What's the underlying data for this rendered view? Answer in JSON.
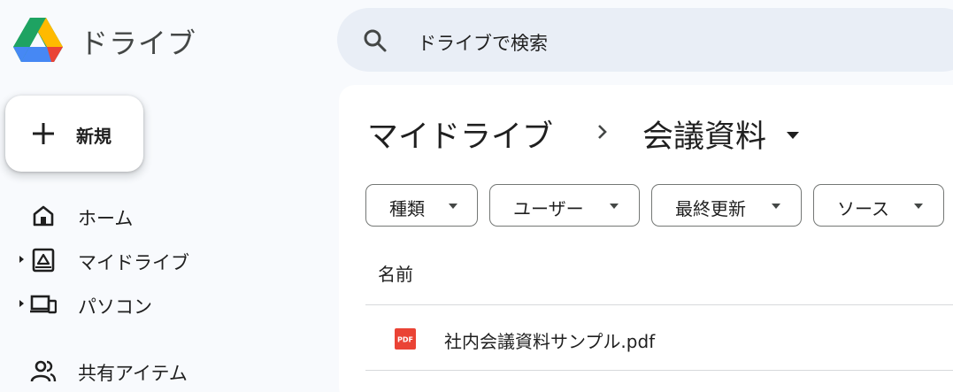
{
  "app": {
    "title": "ドライブ"
  },
  "search": {
    "placeholder": "ドライブで検索"
  },
  "sidebar": {
    "new_label": "新規",
    "items": [
      {
        "label": "ホーム",
        "icon": "home-icon"
      },
      {
        "label": "マイドライブ",
        "icon": "my-drive-icon"
      },
      {
        "label": "パソコン",
        "icon": "computers-icon"
      },
      {
        "label": "共有アイテム",
        "icon": "shared-icon"
      }
    ]
  },
  "breadcrumb": {
    "root": "マイドライブ",
    "current": "会議資料"
  },
  "filters": [
    {
      "label": "種類"
    },
    {
      "label": "ユーザー"
    },
    {
      "label": "最終更新"
    },
    {
      "label": "ソース"
    }
  ],
  "table": {
    "columns": [
      "名前"
    ],
    "rows": [
      {
        "name": "社内会議資料サンプル.pdf",
        "icon": "pdf-icon",
        "icon_label": "PDF"
      }
    ]
  },
  "colors": {
    "background": "#f8fafd",
    "search_bg": "#e9eef6",
    "pdf_red": "#ea4335",
    "drive_green": "#1ea362",
    "drive_blue": "#4688f4",
    "drive_yellow": "#ffba00"
  }
}
